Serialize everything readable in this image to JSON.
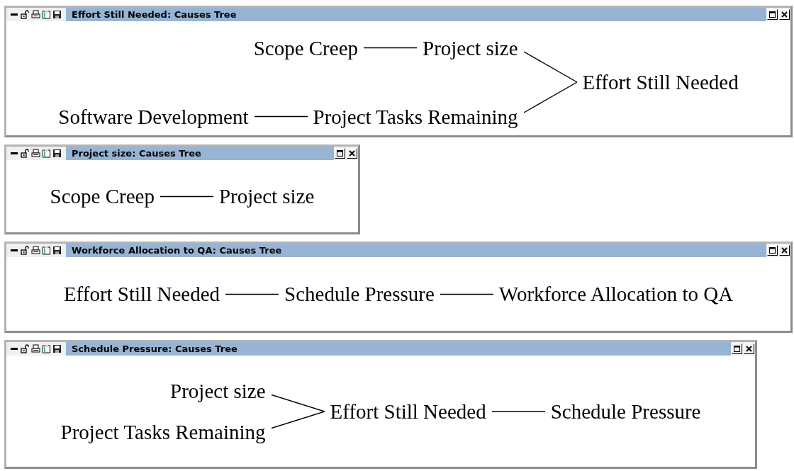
{
  "windows": [
    {
      "title": "Effort Still Needed: Causes Tree",
      "tree": {
        "label": "Effort Still Needed",
        "causes": [
          {
            "label": "Project size",
            "causes": [
              {
                "label": "Scope Creep"
              }
            ]
          },
          {
            "label": "Project Tasks Remaining",
            "causes": [
              {
                "label": "Software Development"
              }
            ]
          }
        ]
      }
    },
    {
      "title": "Project size: Causes Tree",
      "tree": {
        "label": "Project size",
        "causes": [
          {
            "label": "Scope Creep"
          }
        ]
      }
    },
    {
      "title": "Workforce Allocation to QA: Causes Tree",
      "tree": {
        "label": "Workforce Allocation to QA",
        "causes": [
          {
            "label": "Schedule Pressure",
            "causes": [
              {
                "label": "Effort Still Needed"
              }
            ]
          }
        ]
      }
    },
    {
      "title": "Schedule Pressure: Causes Tree",
      "tree": {
        "label": "Schedule Pressure",
        "causes": [
          {
            "label": "Effort Still Needed",
            "causes": [
              {
                "label": "Project size"
              },
              {
                "label": "Project Tasks Remaining"
              }
            ]
          }
        ]
      }
    }
  ]
}
